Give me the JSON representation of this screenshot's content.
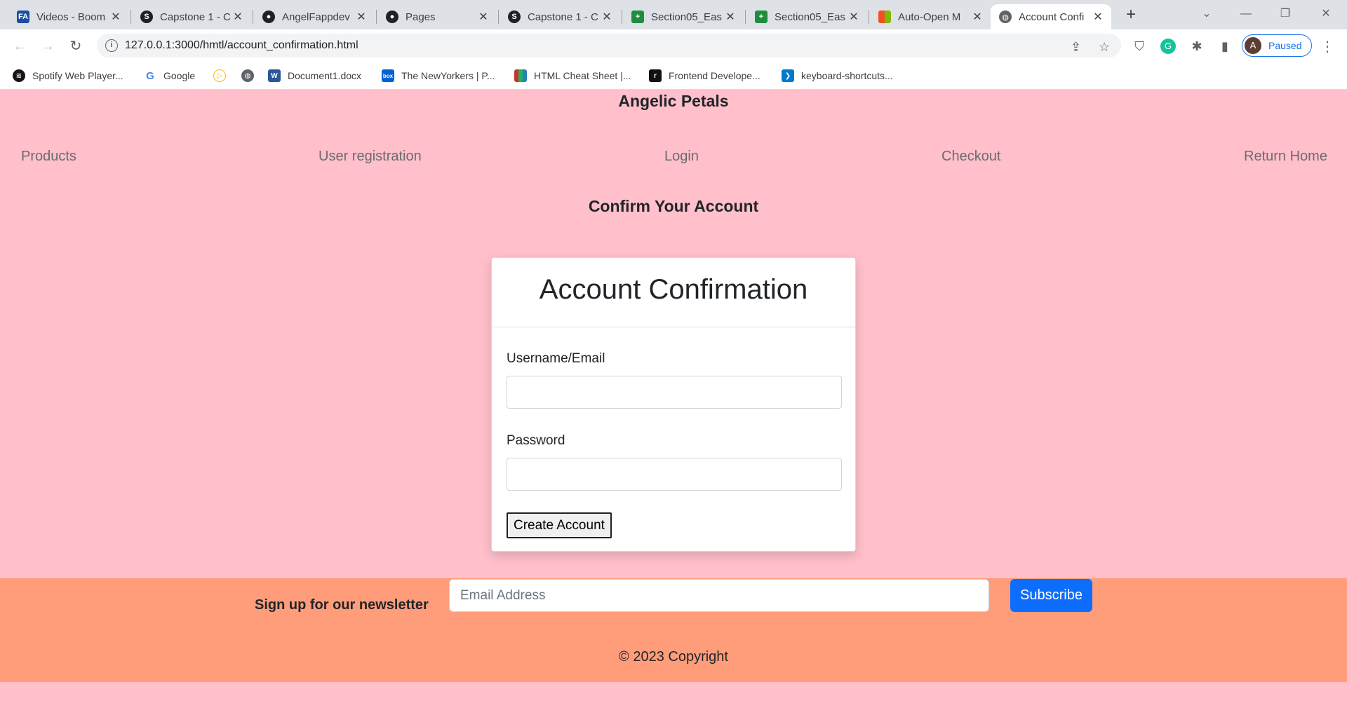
{
  "browser": {
    "tabs": [
      {
        "title": "Videos - Boom",
        "icon": "boom-icon",
        "color": "#1a4fa0"
      },
      {
        "title": "Capstone 1 - C",
        "icon": "capstone-icon",
        "color": "#202124"
      },
      {
        "title": "AngelFappdev",
        "icon": "github-icon",
        "color": "#202124"
      },
      {
        "title": "Pages",
        "icon": "github-icon",
        "color": "#202124"
      },
      {
        "title": "Capstone 1 - C",
        "icon": "capstone-icon",
        "color": "#202124"
      },
      {
        "title": "Section05_Eas",
        "icon": "sheets-icon",
        "color": "#1e8e3e"
      },
      {
        "title": "Section05_Eas",
        "icon": "sheets-icon",
        "color": "#1e8e3e"
      },
      {
        "title": "Auto-Open M",
        "icon": "microsoft-icon",
        "color": "#f25022"
      },
      {
        "title": "Account Confi",
        "icon": "globe-icon",
        "color": "#5f6368"
      }
    ],
    "url": "127.0.0.1:3000/hmtl/account_confirmation.html",
    "profile": {
      "initial": "A",
      "status": "Paused"
    },
    "bookmarks": [
      {
        "label": "Spotify Web Player...",
        "icon": "spotify-icon",
        "color": "#191414"
      },
      {
        "label": "Google",
        "icon": "google-icon",
        "color": "#4285f4"
      },
      {
        "label": "",
        "icon": "play-icon",
        "color": "#fbbc04"
      },
      {
        "label": "",
        "icon": "globe-icon",
        "color": "#5f6368"
      },
      {
        "label": "Document1.docx",
        "icon": "word-icon",
        "color": "#2b579a"
      },
      {
        "label": "The NewYorkers | P...",
        "icon": "box-icon",
        "color": "#0061d5"
      },
      {
        "label": "HTML Cheat Sheet |...",
        "icon": "cheatsheet-icon",
        "color": "#c0392b"
      },
      {
        "label": "Frontend Develope...",
        "icon": "frontend-icon",
        "color": "#111111"
      },
      {
        "label": "keyboard-shortcuts...",
        "icon": "vscode-icon",
        "color": "#007acc"
      }
    ]
  },
  "site": {
    "title": "Angelic Petals",
    "nav": [
      "Products",
      "User registration",
      "Login",
      "Checkout",
      "Return Home"
    ],
    "heading": "Confirm Your Account"
  },
  "card": {
    "title": "Account Confirmation",
    "username_label": "Username/Email",
    "username_value": "",
    "password_label": "Password",
    "password_value": "",
    "button": "Create Account"
  },
  "footer": {
    "newsletter_label": "Sign up for our newsletter",
    "email_placeholder": "Email Address",
    "subscribe": "Subscribe",
    "copyright": "© 2023 Copyright"
  },
  "colors": {
    "page_bg": "#ffbfcb",
    "footer_bg": "#ff9d7b",
    "subscribe_bg": "#0d6efd",
    "profile_accent": "#1a73e8"
  }
}
